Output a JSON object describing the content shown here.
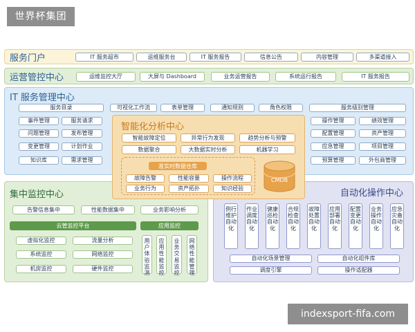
{
  "logo": "世界杯集团",
  "watermark": "indexsport-fifa.com",
  "portal": {
    "title": "服务门户",
    "items": [
      "IT 服务超市",
      "运维服务台",
      "IT 服务报告",
      "信息公告",
      "内容管理",
      "多渠道接入"
    ]
  },
  "ops": {
    "title": "运营管控中心",
    "items": [
      "运维监控大厅",
      "大屏与 Dashboard",
      "业务运营报告",
      "系统运行报告",
      "IT 服务报告"
    ]
  },
  "itsm": {
    "title": "IT 服务管理中心",
    "row0": [
      "服务目录",
      "可视化工作流",
      "表单管理",
      "通知规则",
      "角色权限",
      "服务级别管理"
    ],
    "left": [
      "事件管理",
      "服务请求",
      "问题管理",
      "发布管理",
      "变更管理",
      "计划作业",
      "知识库",
      "需求管理"
    ],
    "right": [
      "操作管理",
      "绩效管理",
      "配置管理",
      "资产管理",
      "应急管理",
      "项目管理",
      "预算管理",
      "外包商管理"
    ]
  },
  "ai": {
    "title": "智能化分析中心",
    "items": [
      "智能故障定位",
      "异常行为发现",
      "趋势分析与预警",
      "数据聚合",
      "大数据实时分析",
      "机器学习"
    ],
    "realtime": {
      "title": "准实时数据仓库",
      "items": [
        "故障告警",
        "性能容量",
        "操作流程",
        "业务行为",
        "资产拓扑",
        "知识经验"
      ]
    },
    "cmdb": "CMDB"
  },
  "monitor": {
    "title": "集中监控中心",
    "top": [
      "告警信息集中",
      "性能数据集中",
      "业务影响分析"
    ],
    "cloud_title": "云管监控平台",
    "cloud_items": [
      "虚拟化监控",
      "流量分析",
      "系统监控",
      "网络监控",
      "机房监控",
      "硬件监控"
    ],
    "app_title": "应用监控",
    "app_items": [
      "用户体验监测",
      "应用性能监控",
      "业务交易监控",
      "网络性能管理"
    ]
  },
  "automation": {
    "title": "自动化操作中心",
    "items": [
      "例行维护自动化",
      "作业调度自动化",
      "健康巡检自动化",
      "合规检查自动化",
      "故障处置自动化",
      "应用部署自动化",
      "配置变更自动化",
      "业务操作自动化",
      "应急灾备自动化"
    ],
    "bottom": [
      "自动化场景管理",
      "自动化组件库",
      "调度引擎",
      "操作适配器"
    ]
  }
}
